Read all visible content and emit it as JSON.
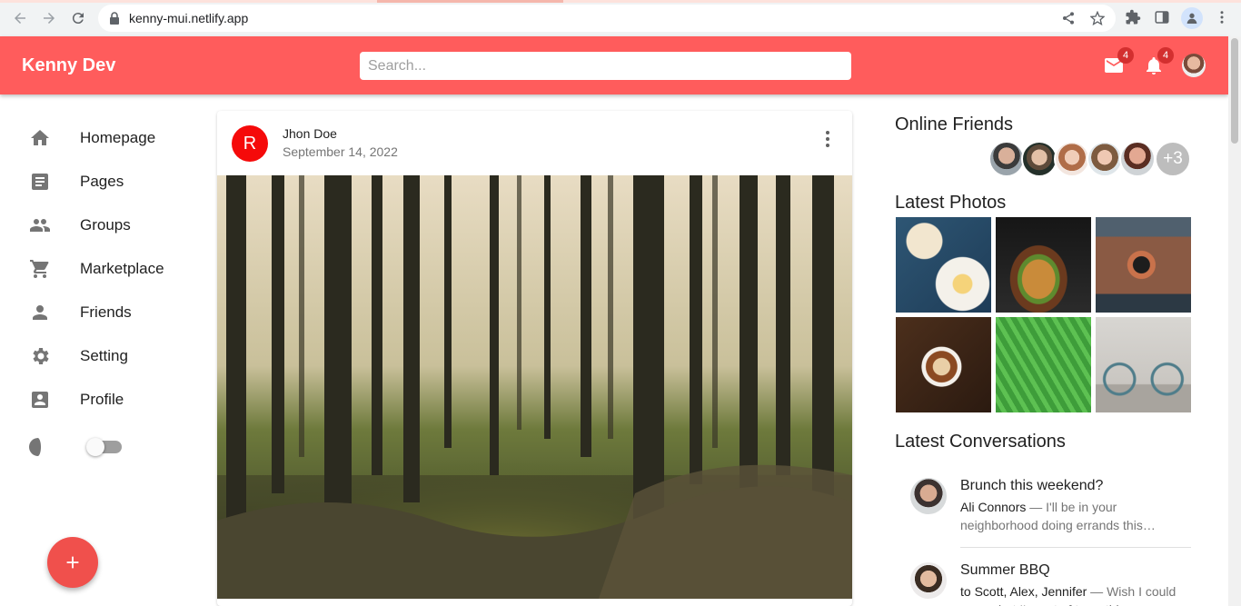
{
  "browser": {
    "url": "kenny-mui.netlify.app"
  },
  "appbar": {
    "logo": "Kenny Dev",
    "search_placeholder": "Search...",
    "mail_badge": "4",
    "notifications_badge": "4"
  },
  "sidebar": {
    "items": [
      {
        "label": "Homepage",
        "icon": "home-icon"
      },
      {
        "label": "Pages",
        "icon": "article-icon"
      },
      {
        "label": "Groups",
        "icon": "group-icon"
      },
      {
        "label": "Marketplace",
        "icon": "cart-icon"
      },
      {
        "label": "Friends",
        "icon": "person-icon"
      },
      {
        "label": "Setting",
        "icon": "settings-icon"
      },
      {
        "label": "Profile",
        "icon": "account-box-icon"
      }
    ],
    "dark_mode": false
  },
  "post": {
    "avatar_letter": "R",
    "author": "Jhon Doe",
    "date": "September 14, 2022"
  },
  "right_panel": {
    "online_title": "Online Friends",
    "online_more": "+3",
    "photos_title": "Latest Photos",
    "conversations_title": "Latest Conversations",
    "conversations": [
      {
        "title": "Brunch this weekend?",
        "who": "Ali Connors",
        "text": " — I'll be in your neighborhood doing errands this…"
      },
      {
        "title": "Summer BBQ",
        "who": "to Scott, Alex, Jennifer",
        "text": " — Wish I could come, but I'm out of town this…"
      }
    ]
  },
  "colors": {
    "primary": "#ff5c5c",
    "fab": "#f0504c",
    "avatar_red": "#f50a0a"
  }
}
